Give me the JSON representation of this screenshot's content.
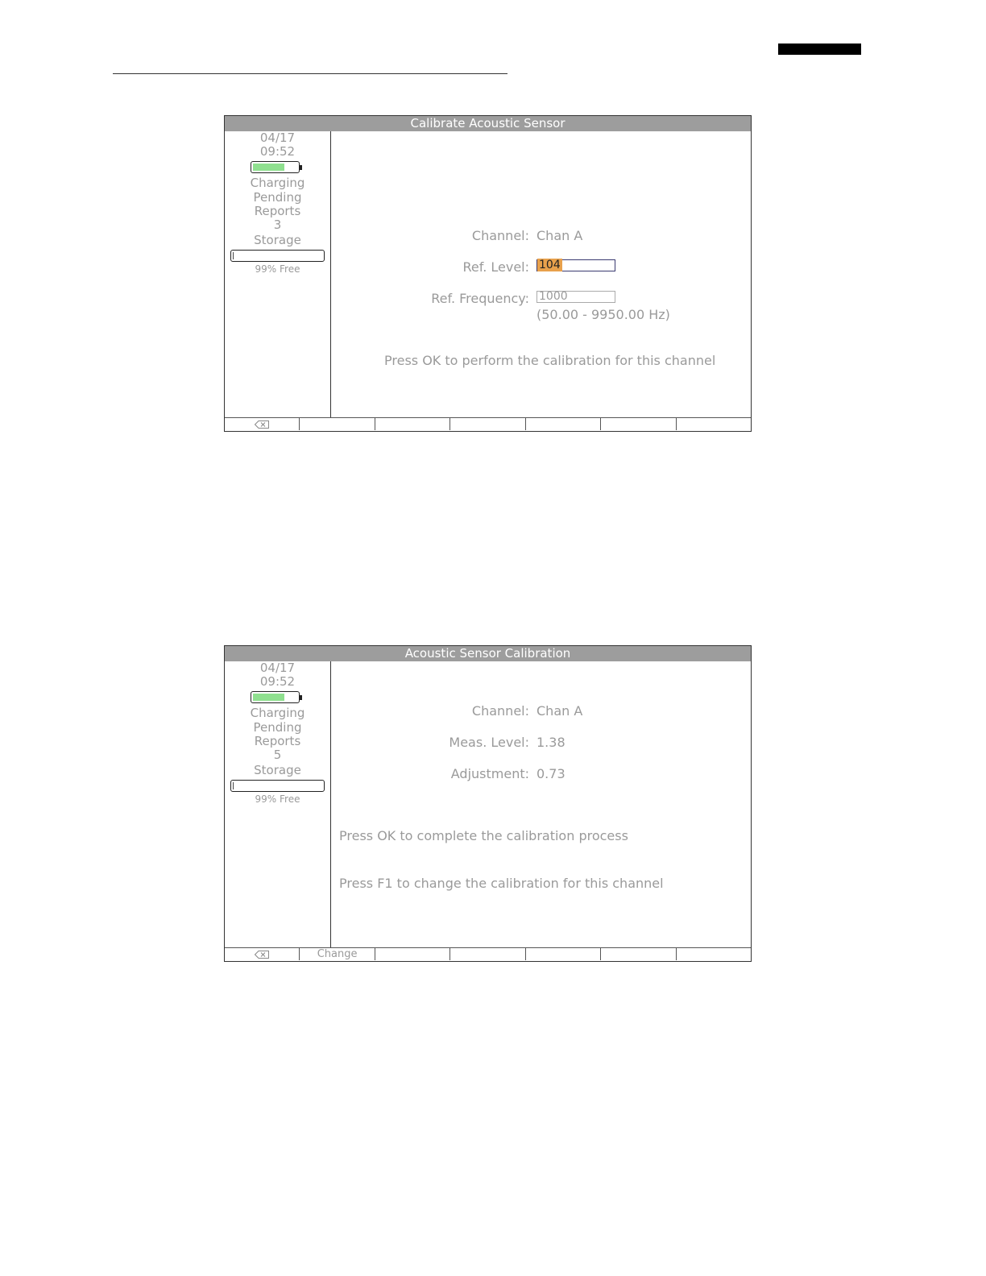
{
  "screens": [
    {
      "title": "Calibrate Acoustic Sensor",
      "sidebar": {
        "date": "04/17",
        "time": "09:52",
        "battery_level": 0.7,
        "battery_status": "Charging",
        "pending_label_1": "Pending",
        "pending_label_2": "Reports",
        "pending_count": "3",
        "storage_label": "Storage",
        "storage_free": "99% Free"
      },
      "fields": {
        "channel_label": "Channel:",
        "channel_value": "Chan A",
        "ref_level_label": "Ref. Level:",
        "ref_level_value": "104",
        "ref_freq_label": "Ref. Frequency:",
        "ref_freq_value": "1000",
        "ref_freq_range": "(50.00 - 9950.00 Hz)"
      },
      "message": "Press OK to perform the calibration for this channel",
      "fkeys": [
        "",
        "",
        "",
        "",
        "",
        "",
        ""
      ]
    },
    {
      "title": "Acoustic Sensor Calibration",
      "sidebar": {
        "date": "04/17",
        "time": "09:52",
        "battery_level": 0.7,
        "battery_status": "Charging",
        "pending_label_1": "Pending",
        "pending_label_2": "Reports",
        "pending_count": "5",
        "storage_label": "Storage",
        "storage_free": "99% Free"
      },
      "fields": {
        "channel_label": "Channel:",
        "channel_value": "Chan A",
        "meas_level_label": "Meas. Level:",
        "meas_level_value": "1.38",
        "adjustment_label": "Adjustment:",
        "adjustment_value": "0.73"
      },
      "message_ok": "Press OK to complete the calibration process",
      "message_f1": "Press F1 to change the calibration for this channel",
      "fkeys": [
        "",
        "Change",
        "",
        "",
        "",
        "",
        ""
      ]
    }
  ]
}
